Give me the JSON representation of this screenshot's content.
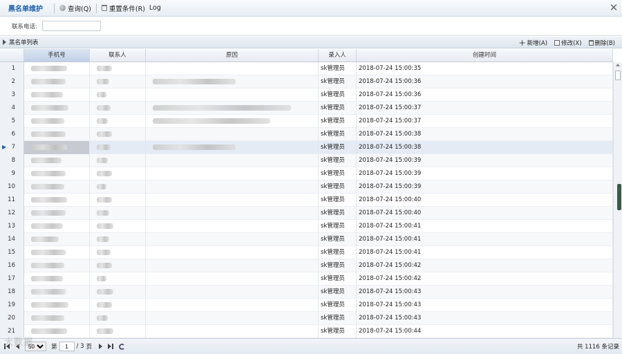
{
  "toolbar": {
    "title": "黑名单维护",
    "query_label": "查询(Q)",
    "reset_label": "重置条件(R)",
    "log_label": "Log",
    "close_glyph": "✕"
  },
  "filter": {
    "phone_label": "联系电话:",
    "phone_value": ""
  },
  "panel": {
    "title": "黑名单列表",
    "add_label": "新增(A)",
    "edit_label": "修改(X)",
    "delete_label": "删除(B)"
  },
  "columns": {
    "phone": "手机号",
    "contact": "联系人",
    "reason": "原因",
    "entered_by": "录入人",
    "created": "创建时间"
  },
  "rows": [
    {
      "n": "1",
      "by": "sk管理员",
      "time": "2018-07-24 15:00:35"
    },
    {
      "n": "2",
      "by": "sk管理员",
      "time": "2018-07-24 15:00:36"
    },
    {
      "n": "3",
      "by": "sk管理员",
      "time": "2018-07-24 15:00:36"
    },
    {
      "n": "4",
      "by": "sk管理员",
      "time": "2018-07-24 15:00:37"
    },
    {
      "n": "5",
      "by": "sk管理员",
      "time": "2018-07-24 15:00:37"
    },
    {
      "n": "6",
      "by": "sk管理员",
      "time": "2018-07-24 15:00:38"
    },
    {
      "n": "7",
      "by": "sk管理员",
      "time": "2018-07-24 15:00:38"
    },
    {
      "n": "8",
      "by": "sk管理员",
      "time": "2018-07-24 15:00:39"
    },
    {
      "n": "9",
      "by": "sk管理员",
      "time": "2018-07-24 15:00:39"
    },
    {
      "n": "10",
      "by": "sk管理员",
      "time": "2018-07-24 15:00:39"
    },
    {
      "n": "11",
      "by": "sk管理员",
      "time": "2018-07-24 15:00:40"
    },
    {
      "n": "12",
      "by": "sk管理员",
      "time": "2018-07-24 15:00:40"
    },
    {
      "n": "13",
      "by": "sk管理员",
      "time": "2018-07-24 15:00:41"
    },
    {
      "n": "14",
      "by": "sk管理员",
      "time": "2018-07-24 15:00:41"
    },
    {
      "n": "15",
      "by": "sk管理员",
      "time": "2018-07-24 15:00:41"
    },
    {
      "n": "16",
      "by": "sk管理员",
      "time": "2018-07-24 15:00:42"
    },
    {
      "n": "17",
      "by": "sk管理员",
      "time": "2018-07-24 15:00:42"
    },
    {
      "n": "18",
      "by": "sk管理员",
      "time": "2018-07-24 15:00:43"
    },
    {
      "n": "19",
      "by": "sk管理员",
      "time": "2018-07-24 15:00:43"
    },
    {
      "n": "20",
      "by": "sk管理员",
      "time": "2018-07-24 15:00:43"
    },
    {
      "n": "21",
      "by": "sk管理员",
      "time": "2018-07-24 15:00:44"
    }
  ],
  "current_row": "7",
  "pager": {
    "page_size": "50",
    "page_label": "第",
    "current_page": "1",
    "of_pages": "/ 3",
    "page_suffix": "页",
    "total_text": "共 1116 条记录"
  },
  "watermark": "大数据"
}
